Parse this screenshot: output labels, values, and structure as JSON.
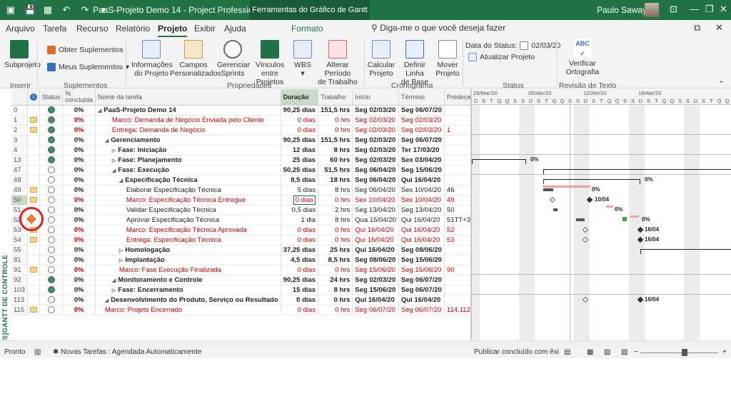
{
  "titlebar": {
    "title": "PaaS-Projeto Demo 14  -  Project Professional",
    "context_tab": "Ferramentas do Gráfico de Gantt",
    "user": "Paulo Sawaya",
    "controls": [
      "🗗",
      "—",
      "☐",
      "✕"
    ]
  },
  "menu": {
    "tabs": [
      "Arquivo",
      "Tarefa",
      "Recurso",
      "Relatório",
      "Projeto",
      "Exibir",
      "Ajuda"
    ],
    "active": "Projeto",
    "format": "Formato",
    "search": "Diga-me o que você deseja fazer"
  },
  "ribbon": {
    "subprojeto": "Subprojeto",
    "obter": "Obter Suplementos",
    "meus": "Meus Suplementos",
    "informacoes": [
      "Informações",
      "do Projeto"
    ],
    "campos": [
      "Campos",
      "Personalizados"
    ],
    "gerenciar": [
      "Gerenciar",
      "Sprints"
    ],
    "vinculos": [
      "Vínculos",
      "entre Projetos"
    ],
    "wbs": "WBS",
    "alterar": [
      "Alterar Período",
      "de Trabalho"
    ],
    "calcular": [
      "Calcular",
      "Projeto"
    ],
    "definir": [
      "Definir Linha",
      "de Base"
    ],
    "mover": [
      "Mover",
      "Projeto"
    ],
    "data_status_label": "Data do Status:",
    "data_status_value": "02/03/20",
    "atualizar": "Atualizar Projeto",
    "verificar": [
      "Verificar",
      "Ortografia"
    ],
    "groups": [
      "Inserir",
      "Suplementos",
      "Propriedades",
      "Cronograma",
      "Status",
      "Revisão de Texto"
    ]
  },
  "sidebar_label": "[PAAS]GANTT DE CONTROLE",
  "columns": [
    "",
    "Status",
    "% concluída",
    "Nome da tarefa",
    "Duração",
    "Trabalho",
    "Início",
    "Término",
    "Predecessoras"
  ],
  "rows": [
    {
      "id": "0",
      "status": "done",
      "pct": "0%",
      "name": "PaaS-Projeto Demo 14",
      "dur": "90,25 dias",
      "work": "151,5 hrs",
      "start": "Seg 02/03/20",
      "end": "Seg 06/07/20",
      "pred": "",
      "level": 0,
      "style": "bold",
      "note": false
    },
    {
      "id": "1",
      "status": "done",
      "pct": "0%",
      "name": "Marco: Demanda de Negócio Enviada pelo Cliente",
      "dur": "0 dias",
      "work": "0 hrs",
      "start": "Seg 02/03/20",
      "end": "Seg 02/03/20",
      "pred": "",
      "level": 2,
      "style": "red",
      "note": true
    },
    {
      "id": "2",
      "status": "done",
      "pct": "0%",
      "name": "Entrega: Demanda de Negócio",
      "dur": "0 dias",
      "work": "0 hrs",
      "start": "Seg 02/03/20",
      "end": "Seg 02/03/20",
      "pred": "1",
      "level": 2,
      "style": "red",
      "note": true
    },
    {
      "id": "3",
      "status": "done",
      "pct": "0%",
      "name": "Gerenciamento",
      "dur": "90,25 dias",
      "work": "151,5 hrs",
      "start": "Seg 02/03/20",
      "end": "Seg 06/07/20",
      "pred": "",
      "level": 1,
      "style": "bold",
      "note": false
    },
    {
      "id": "4",
      "status": "done",
      "pct": "0%",
      "name": "Fase: Iniciação",
      "dur": "12 dias",
      "work": "8 hrs",
      "start": "Seg 02/03/20",
      "end": "Ter 17/03/20",
      "pred": "",
      "level": 2,
      "style": "bold",
      "note": false
    },
    {
      "id": "13",
      "status": "done",
      "pct": "0%",
      "name": "Fase: Planejamento",
      "dur": "25 dias",
      "work": "60 hrs",
      "start": "Seg 02/03/20",
      "end": "Sex 03/04/20",
      "pred": "",
      "level": 2,
      "style": "bold",
      "note": false
    },
    {
      "id": "47",
      "status": "open",
      "pct": "0%",
      "name": "Fase: Execução",
      "dur": "50,25 dias",
      "work": "51,5 hrs",
      "start": "Seg 06/04/20",
      "end": "Seg 15/06/20",
      "pred": "",
      "level": 2,
      "style": "bold",
      "note": false
    },
    {
      "id": "48",
      "status": "open",
      "pct": "0%",
      "name": "Especificação Técnica",
      "dur": "8,5 dias",
      "work": "18 hrs",
      "start": "Seg 06/04/20",
      "end": "Qui 16/04/20",
      "pred": "",
      "level": 3,
      "style": "bold",
      "note": false
    },
    {
      "id": "49",
      "status": "open",
      "pct": "0%",
      "name": "Elaborar Especificação Técnica",
      "dur": "5 dias",
      "work": "8 hrs",
      "start": "Seg 06/04/20",
      "end": "Sex 10/04/20",
      "pred": "46",
      "level": 4,
      "style": "normal",
      "note": true
    },
    {
      "id": "50",
      "status": "open",
      "pct": "0%",
      "name": "Marco: Especificação Técnica Entregue",
      "dur": "0 dias",
      "work": "0 hrs",
      "start": "Sex 10/04/20",
      "end": "Sex 10/04/20",
      "pred": "49",
      "level": 4,
      "style": "red",
      "note": true
    },
    {
      "id": "51",
      "status": "open",
      "pct": "0%",
      "name": "Validar Especificação Técnica",
      "dur": "0,5 dias",
      "work": "2 hrs",
      "start": "Seg 13/04/20",
      "end": "Seg 13/04/20",
      "pred": "50",
      "level": 4,
      "style": "normal",
      "note": false
    },
    {
      "id": "52",
      "status": "open",
      "pct": "0%",
      "name": "Aprovar Especificação Técnica",
      "dur": "1 dia",
      "work": "8 hrs",
      "start": "Qua 15/04/20",
      "end": "Qui 16/04/20",
      "pred": "51TT+3 dias",
      "level": 4,
      "style": "normal",
      "note": false
    },
    {
      "id": "53",
      "status": "open",
      "pct": "0%",
      "name": "Marco: Especificação Técnica Aprovada",
      "dur": "0 dias",
      "work": "0 hrs",
      "start": "Qui 16/04/20",
      "end": "Qui 16/04/20",
      "pred": "52",
      "level": 4,
      "style": "red",
      "note": true
    },
    {
      "id": "54",
      "status": "open",
      "pct": "0%",
      "name": "Entrega: Especificação Técnica",
      "dur": "0 dias",
      "work": "0 hrs",
      "start": "Qui 16/04/20",
      "end": "Qui 16/04/20",
      "pred": "53",
      "level": 4,
      "style": "red",
      "note": true
    },
    {
      "id": "55",
      "status": "open",
      "pct": "0%",
      "name": "Homologação",
      "dur": "37,25 dias",
      "work": "25 hrs",
      "start": "Qui 16/04/20",
      "end": "Seg 08/06/20",
      "pred": "",
      "level": 3,
      "style": "bold",
      "note": false
    },
    {
      "id": "81",
      "status": "open",
      "pct": "0%",
      "name": "Implantação",
      "dur": "4,5 dias",
      "work": "8,5 hrs",
      "start": "Seg 08/06/20",
      "end": "Seg 15/06/20",
      "pred": "",
      "level": 3,
      "style": "bold",
      "note": false
    },
    {
      "id": "91",
      "status": "open",
      "pct": "0%",
      "name": "Marco: Fase Execução Finalizada",
      "dur": "0 dias",
      "work": "0 hrs",
      "start": "Seg 15/06/20",
      "end": "Seg 15/06/20",
      "pred": "90",
      "level": 3,
      "style": "red",
      "note": true
    },
    {
      "id": "92",
      "status": "done",
      "pct": "0%",
      "name": "Monitoramento e Controle",
      "dur": "90,25 dias",
      "work": "24 hrs",
      "start": "Seg 02/03/20",
      "end": "Seg 06/07/20",
      "pred": "",
      "level": 2,
      "style": "bold",
      "note": false
    },
    {
      "id": "103",
      "status": "done",
      "pct": "0%",
      "name": "Fase: Encerramento",
      "dur": "15 dias",
      "work": "8 hrs",
      "start": "Seg 15/06/20",
      "end": "Seg 06/07/20",
      "pred": "",
      "level": 2,
      "style": "bold",
      "note": false
    },
    {
      "id": "113",
      "status": "open",
      "pct": "0%",
      "name": "Desenvolvimento do Produto, Serviço ou Resultado",
      "dur": "0 dias",
      "work": "0 hrs",
      "start": "Qui 16/04/20",
      "end": "Qui 16/04/20",
      "pred": "",
      "level": 1,
      "style": "bold",
      "note": false
    },
    {
      "id": "115",
      "status": "open",
      "pct": "0%",
      "name": "Marco: Projeto Encerrado",
      "dur": "0 dias",
      "work": "0 hrs",
      "start": "Seg 06/07/20",
      "end": "Seg 06/07/20",
      "pred": "114,112",
      "level": 1,
      "style": "red",
      "note": true
    }
  ],
  "gantt": {
    "weeks": [
      "29/Mar/20",
      "05/Abr/20",
      "12/Abr/20",
      "19/Abr/20"
    ],
    "days": [
      "D",
      "S",
      "T",
      "Q",
      "Q",
      "S",
      "S",
      "D",
      "S",
      "T",
      "Q",
      "Q",
      "S",
      "S",
      "D",
      "S",
      "T",
      "Q",
      "Q",
      "S",
      "S",
      "D",
      "S",
      "T",
      "Q",
      "Q",
      "S",
      "S",
      "D",
      "S",
      "T",
      "Q",
      "Q"
    ],
    "labels": {
      "l47": "0%",
      "l48": "0%",
      "l49": "0%",
      "l50": "10/04",
      "l51": "0%",
      "l52": "0%",
      "l53": "16/04",
      "l54": "16/04",
      "l113": "16/04"
    }
  },
  "status": {
    "ready": "Pronto",
    "tasks": "Novas Tarefas : Agendada Automaticamente",
    "publish": "Publicar concluído com êxi"
  }
}
